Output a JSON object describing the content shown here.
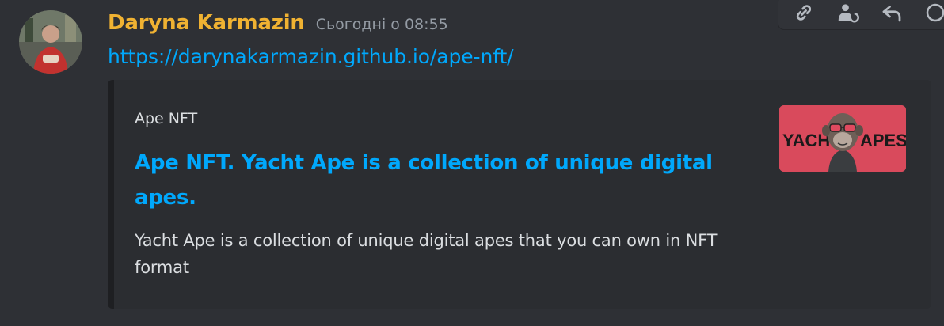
{
  "message": {
    "author": "Daryna Karmazin",
    "timestamp": "Сьогодні о 08:55",
    "link_text": "https://darynakarmazin.github.io/ape-nft/"
  },
  "embed": {
    "provider": "Ape NFT",
    "title": "Ape NFT. Yacht Ape is a collection of unique digital apes.",
    "description": "Yacht Ape is a collection of unique digital apes that you can own in NFT format",
    "thumbnail": {
      "word_left": "YACHT",
      "word_right": "APES"
    }
  },
  "toolbar": {
    "icons": [
      "link-icon",
      "app-reply-icon",
      "reply-icon",
      "more-icon"
    ]
  },
  "colors": {
    "background": "#2e3035",
    "embed_background": "#2b2d31",
    "embed_border": "#1e1f22",
    "username": "#f0b232",
    "link": "#00a8fc",
    "text": "#dbdee1",
    "muted": "#949ba4",
    "thumbnail": "#d94a5c"
  }
}
